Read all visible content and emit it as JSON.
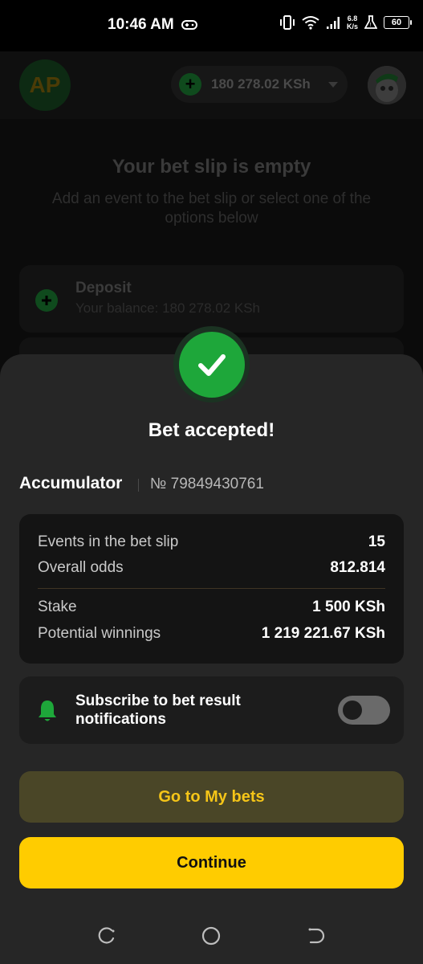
{
  "status_bar": {
    "time": "10:46 AM",
    "net_speed_value": "6.8",
    "net_speed_unit": "K/s",
    "battery": "60",
    "icons": [
      "gamepad-icon",
      "vibrate-icon",
      "wifi-icon",
      "signal-icon",
      "lab-icon",
      "battery-icon"
    ]
  },
  "header": {
    "logo_text": "AP",
    "balance": "180 278.02 KSh"
  },
  "background": {
    "empty_title": "Your bet slip is empty",
    "empty_subtitle": "Add an event to the bet slip or select one of the options below",
    "deposit_title": "Deposit",
    "deposit_balance": "Your balance: 180 278.02 KSh"
  },
  "sheet": {
    "title": "Bet accepted!",
    "bet_type": "Accumulator",
    "bet_number": "№ 79849430761",
    "summary": {
      "events_label": "Events in the bet slip",
      "events_value": "15",
      "odds_label": "Overall odds",
      "odds_value": "812.814",
      "stake_label": "Stake",
      "stake_value": "1 500 KSh",
      "winnings_label": "Potential winnings",
      "winnings_value": "1 219 221.67 KSh"
    },
    "notify_label": "Subscribe to bet result notifications",
    "notify_enabled": false,
    "go_to_bets": "Go to My bets",
    "continue": "Continue"
  },
  "colors": {
    "accent_yellow": "#ffcc00",
    "success_green": "#1ea73a",
    "sheet_bg": "#262626"
  }
}
